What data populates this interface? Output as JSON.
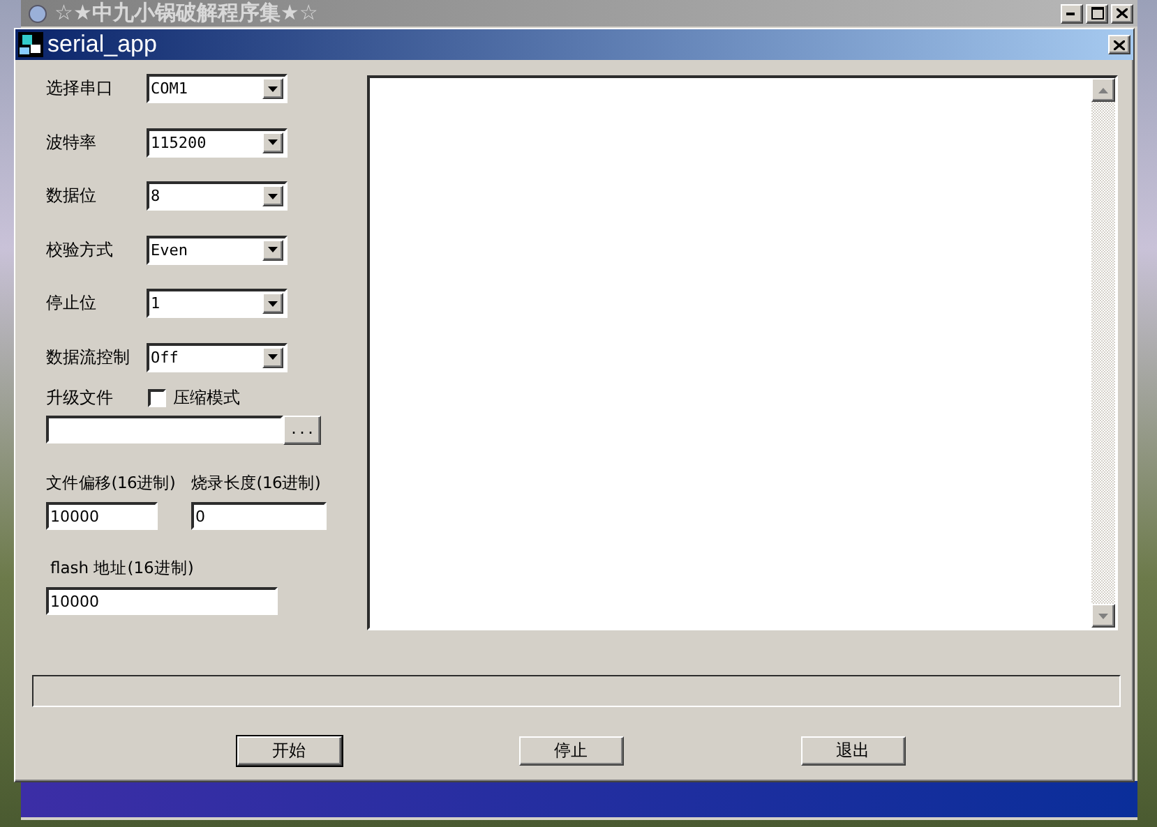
{
  "background_window": {
    "title": "☆★中九小锅破解程序集★☆"
  },
  "window": {
    "title": "serial_app"
  },
  "settings": [
    {
      "label": "选择串口",
      "value": "COM1"
    },
    {
      "label": "波特率",
      "value": "115200"
    },
    {
      "label": "数据位",
      "value": "8"
    },
    {
      "label": "校验方式",
      "value": "Even"
    },
    {
      "label": "停止位",
      "value": "1"
    },
    {
      "label": "数据流控制",
      "value": "Off"
    }
  ],
  "upgrade_file": {
    "label": "升级文件",
    "compress": {
      "label": "压缩模式",
      "checked": false
    },
    "browse_button": "..."
  },
  "file_offset": {
    "label": "文件偏移(16进制)",
    "value": "10000"
  },
  "burn_length": {
    "label": "烧录长度(16进制)",
    "value": "0"
  },
  "flash_address": {
    "label": "flash 地址(16进制)",
    "value": "10000"
  },
  "progress": {
    "level": 0
  },
  "buttons": [
    {
      "label": "开始",
      "default": true
    },
    {
      "label": "停止",
      "default": false
    },
    {
      "label": "退出",
      "default": false
    }
  ]
}
